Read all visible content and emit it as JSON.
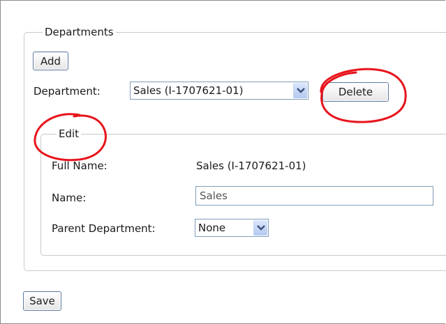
{
  "departments": {
    "legend": "Departments",
    "add_label": "Add",
    "department_label": "Department:",
    "department_selected": "Sales (I-1707621-01)",
    "delete_label": "Delete"
  },
  "edit": {
    "legend": "Edit",
    "full_name_label": "Full Name:",
    "full_name_value": "Sales (I-1707621-01)",
    "name_label": "Name:",
    "name_value": "Sales",
    "parent_label": "Parent Department:",
    "parent_selected": "None"
  },
  "save_label": "Save",
  "icons": {
    "select_arrow": "chevron-down-icon"
  },
  "colors": {
    "annotation": "#e8141c",
    "button_border": "#5b7899",
    "field_border": "#7f9db9"
  }
}
